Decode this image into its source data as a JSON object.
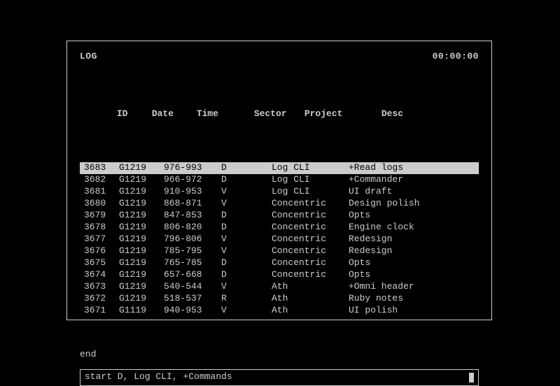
{
  "header": {
    "title": "LOG",
    "timestamp": "00:00:00"
  },
  "columns": {
    "id": "ID",
    "date": "Date",
    "time": "Time",
    "sector": "Sector",
    "project": "Project",
    "desc": "Desc"
  },
  "rows": [
    {
      "id": "3683",
      "date": "G1219",
      "time": "976-993",
      "sector": "D",
      "project": "Log CLI",
      "desc": "+Read logs",
      "selected": true
    },
    {
      "id": "3682",
      "date": "G1219",
      "time": "966-972",
      "sector": "D",
      "project": "Log CLI",
      "desc": "+Commander",
      "selected": false
    },
    {
      "id": "3681",
      "date": "G1219",
      "time": "910-953",
      "sector": "V",
      "project": "Log CLI",
      "desc": "UI draft",
      "selected": false
    },
    {
      "id": "3680",
      "date": "G1219",
      "time": "868-871",
      "sector": "V",
      "project": "Concentric",
      "desc": "Design polish",
      "selected": false
    },
    {
      "id": "3679",
      "date": "G1219",
      "time": "847-853",
      "sector": "D",
      "project": "Concentric",
      "desc": "Opts",
      "selected": false
    },
    {
      "id": "3678",
      "date": "G1219",
      "time": "806-820",
      "sector": "D",
      "project": "Concentric",
      "desc": "Engine clock",
      "selected": false
    },
    {
      "id": "3677",
      "date": "G1219",
      "time": "796-806",
      "sector": "V",
      "project": "Concentric",
      "desc": "Redesign",
      "selected": false
    },
    {
      "id": "3676",
      "date": "G1219",
      "time": "785-795",
      "sector": "V",
      "project": "Concentric",
      "desc": "Redesign",
      "selected": false
    },
    {
      "id": "3675",
      "date": "G1219",
      "time": "765-785",
      "sector": "D",
      "project": "Concentric",
      "desc": "Opts",
      "selected": false
    },
    {
      "id": "3674",
      "date": "G1219",
      "time": "657-668",
      "sector": "D",
      "project": "Concentric",
      "desc": "Opts",
      "selected": false
    },
    {
      "id": "3673",
      "date": "G1219",
      "time": "540-544",
      "sector": "V",
      "project": "Ath",
      "desc": "+Omni header",
      "selected": false
    },
    {
      "id": "3672",
      "date": "G1219",
      "time": "518-537",
      "sector": "R",
      "project": "Ath",
      "desc": "Ruby notes",
      "selected": false
    },
    {
      "id": "3671",
      "date": "G1119",
      "time": "940-953",
      "sector": "V",
      "project": "Ath",
      "desc": "UI polish",
      "selected": false
    }
  ],
  "footer": {
    "end_label": "end"
  },
  "command": {
    "value": "start D, Log CLI, +Commands"
  }
}
